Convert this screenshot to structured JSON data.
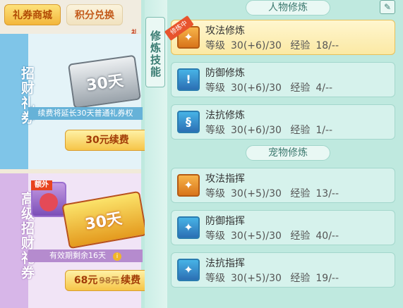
{
  "tabs": {
    "mall": "礼券商城",
    "points": "积分兑换"
  },
  "gift_tag": "礼",
  "card_normal": {
    "label": "招财礼券",
    "voucher_text": "30天",
    "desc": "续费将延长30天普通礼券权",
    "button": "30元续费"
  },
  "card_premium": {
    "label": "高级招财礼券",
    "extra_badge": "额外",
    "voucher_text": "30天",
    "desc": "有效期剩余16天",
    "price_new": "68元",
    "price_old": "98元",
    "price_suffix": "续费"
  },
  "strip_label": "修炼技能",
  "sections": {
    "character": "人物修炼",
    "pet": "宠物修炼"
  },
  "stat_labels": {
    "level": "等级",
    "exp": "经验"
  },
  "training_tag": "修炼中",
  "character_skills": [
    {
      "name": "攻法修炼",
      "level": "30(+6)/30",
      "exp": "18/--",
      "icon": "paw-icon",
      "selected": true
    },
    {
      "name": "防御修炼",
      "level": "30(+6)/30",
      "exp": "4/--",
      "icon": "shield-icon",
      "selected": false
    },
    {
      "name": "法抗修炼",
      "level": "30(+6)/30",
      "exp": "1/--",
      "icon": "swirl-icon",
      "selected": false
    }
  ],
  "pet_skills": [
    {
      "name": "攻法指挥",
      "level": "30(+5)/30",
      "exp": "13/--",
      "icon": "paw-icon"
    },
    {
      "name": "防御指挥",
      "level": "30(+5)/30",
      "exp": "40/--",
      "icon": "paw-shield-icon"
    },
    {
      "name": "法抗指挥",
      "level": "30(+5)/30",
      "exp": "19/--",
      "icon": "paw-swirl-icon"
    }
  ]
}
